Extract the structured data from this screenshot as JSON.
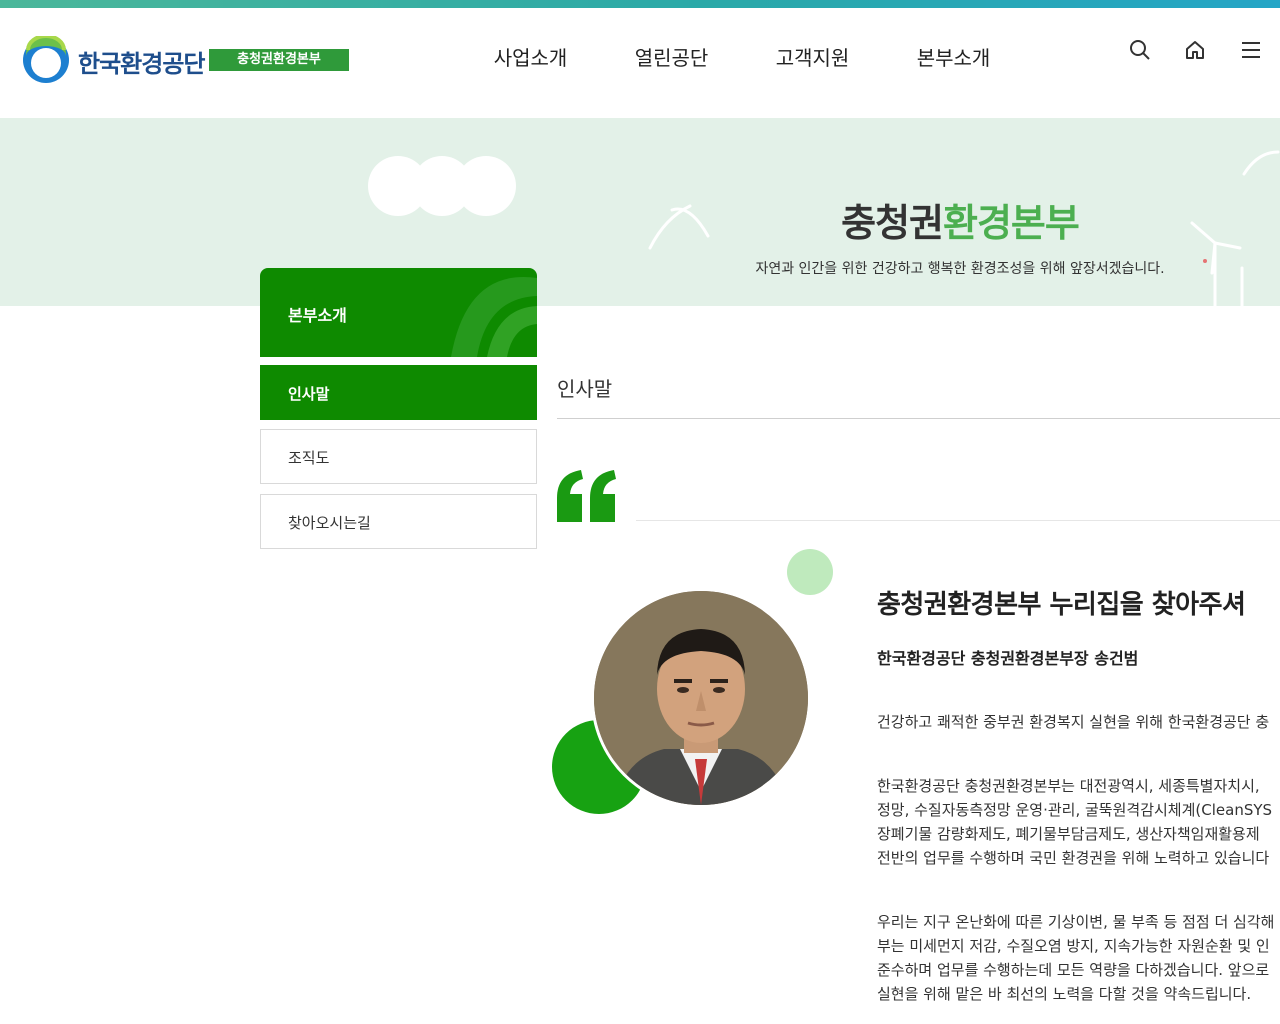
{
  "header": {
    "logo_text": "한국환경공단",
    "logo_badge": "충청권환경본부",
    "nav": [
      "사업소개",
      "열린공단",
      "고객지원",
      "본부소개"
    ]
  },
  "hero": {
    "title_part1": "충청권",
    "title_part2": "환경본부",
    "subtitle": "자연과 인간을 위한 건강하고 행복한 환경조성을 위해 앞장서겠습니다."
  },
  "sidebar": {
    "heading": "본부소개",
    "items": [
      {
        "label": "인사말",
        "active": true
      },
      {
        "label": "조직도",
        "active": false
      },
      {
        "label": "찾아오시는길",
        "active": false
      }
    ]
  },
  "content": {
    "page_title": "인사말",
    "headline": "충청권환경본부 누리집을 찾아주셔",
    "signature": "한국환경공단 충청권환경본부장 송건범",
    "para1": [
      "건강하고 쾌적한 중부권 환경복지 실현을 위해 한국환경공단 충"
    ],
    "para2": [
      "한국환경공단 충청권환경본부는 대전광역시, 세종특별자치시,",
      "정망, 수질자동측정망 운영·관리, 굴뚝원격감시체계(CleanSYS",
      "장폐기물 감량화제도, 폐기물부담금제도, 생산자책임재활용제",
      "전반의 업무를 수행하며 국민 환경권을 위해 노력하고 있습니다"
    ],
    "para3": [
      "우리는 지구 온난화에 따른 기상이변, 물 부족 등 점점 더 심각해",
      "부는 미세먼지 저감, 수질오염 방지, 지속가능한 자원순환 및 인",
      "준수하며 업무를 수행하는데 모든 역량을 다하겠습니다. 앞으로",
      "실현을 위해 맡은 바 최선의 노력을 다할 것을 약속드립니다."
    ]
  },
  "colors": {
    "primary_green": "#0e8a00",
    "hero_bg": "#e3f1e8",
    "hero_accent": "#4caf50",
    "topbar": "#2aa9a8"
  }
}
